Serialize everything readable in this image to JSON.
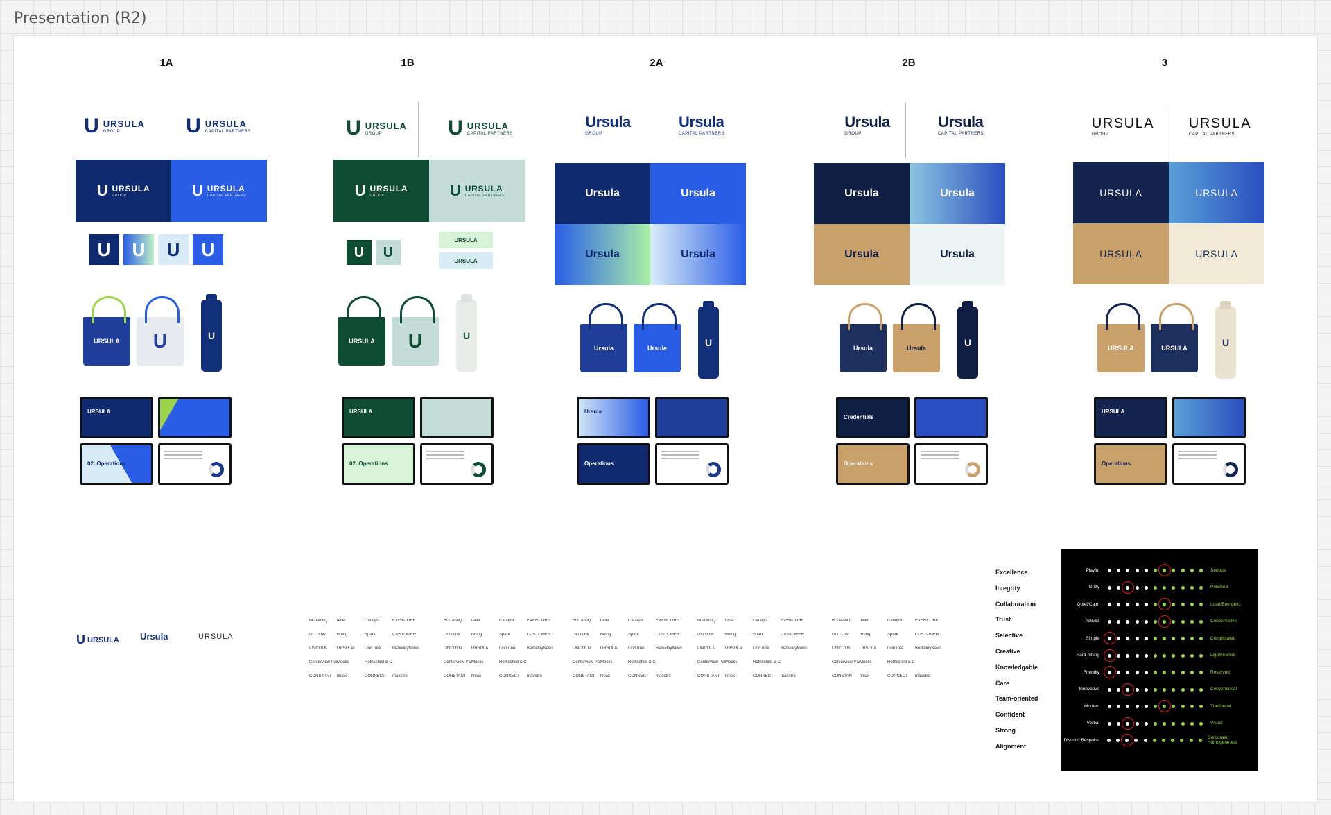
{
  "frame": {
    "title": "Presentation (R2)"
  },
  "columns": [
    {
      "label": "1A",
      "logo_primary": "URSULA",
      "sub_group": "GROUP",
      "sub_partners": "CAPITAL PARTNERS",
      "slide_title": "02. Operations",
      "slide_heading": "Diversified Customer List"
    },
    {
      "label": "1B",
      "logo_primary": "URSULA",
      "sub_group": "GROUP",
      "sub_partners": "CAPITAL PARTNERS",
      "slide_title": "02. Operations",
      "slide_heading": "Diversified Customer List"
    },
    {
      "label": "2A",
      "logo_primary": "Ursula",
      "sub_group": "GROUP",
      "sub_partners": "CAPITAL PARTNERS",
      "slide_title": "Operations",
      "slide_cover": "Ursula",
      "slide_heading": "Diversified Customer List"
    },
    {
      "label": "2B",
      "logo_primary": "Ursula",
      "sub_group": "GROUP",
      "sub_partners": "CAPITAL PARTNERS",
      "slide_title": "Operations",
      "slide_cover": "Credentials",
      "slide_heading": "Diversified Customer List"
    },
    {
      "label": "3",
      "logo_primary": "URSULA",
      "sub_group": "GROUP",
      "sub_partners": "CAPITAL PARTNERS",
      "slide_title": "Operations",
      "slide_cover": "URSULA",
      "slide_heading": "Diversified Customer List"
    }
  ],
  "bag_label": "URSULA",
  "bag_label_script": "Ursula",
  "bottle_mark": "U",
  "footer": {
    "logo_a": "URSULA",
    "logo_b": "Ursula",
    "logo_c": "URSULA",
    "sub": "GROUP"
  },
  "partners": [
    "BOTANIQ",
    "teller",
    "Catalyst",
    "EVERCORE",
    "GITTOW",
    "Boing",
    "Spark",
    "CUSTOMER",
    "LINCOLN",
    "URSULA",
    "LionTree",
    "BerkeleyNews",
    "Centerview Partners",
    "Moelis",
    "Rothschild & Co",
    "",
    "CONSTANT",
    "finiax",
    "CONNECT",
    "maestro"
  ],
  "values": [
    "Excellence",
    "Integrity",
    "Collaboration",
    "Trust",
    "Selective",
    "Creative",
    "Knowledgable",
    "Care",
    "Team-oriented",
    "Confident",
    "Strong",
    "Alignment"
  ],
  "scale_rows": [
    {
      "left": "Playful",
      "right": "Serious",
      "pos": 6
    },
    {
      "left": "Gritty",
      "right": "Polished",
      "pos": 2
    },
    {
      "left": "Quiet/Calm",
      "right": "Loud/Energetic",
      "pos": 6
    },
    {
      "left": "Activist",
      "right": "Conservative",
      "pos": 6
    },
    {
      "left": "Simple",
      "right": "Complicated",
      "pos": 0
    },
    {
      "left": "Hard-hitting",
      "right": "Lighthearted",
      "pos": 0
    },
    {
      "left": "Friendly",
      "right": "Reserved",
      "pos": 0
    },
    {
      "left": "Innovative",
      "right": "Conventional",
      "pos": 2
    },
    {
      "left": "Modern",
      "right": "Traditional",
      "pos": 6
    },
    {
      "left": "Verbal",
      "right": "Visual",
      "pos": 2
    },
    {
      "left": "Distinct/ Bespoke",
      "right": "Corporate/ Homogeneous",
      "pos": 2
    }
  ],
  "colors": {
    "navy": "#0f2a6e",
    "blue": "#2a5de6",
    "green": "#0e4d34",
    "gold": "#caa06a",
    "lime": "#9bd44a"
  }
}
